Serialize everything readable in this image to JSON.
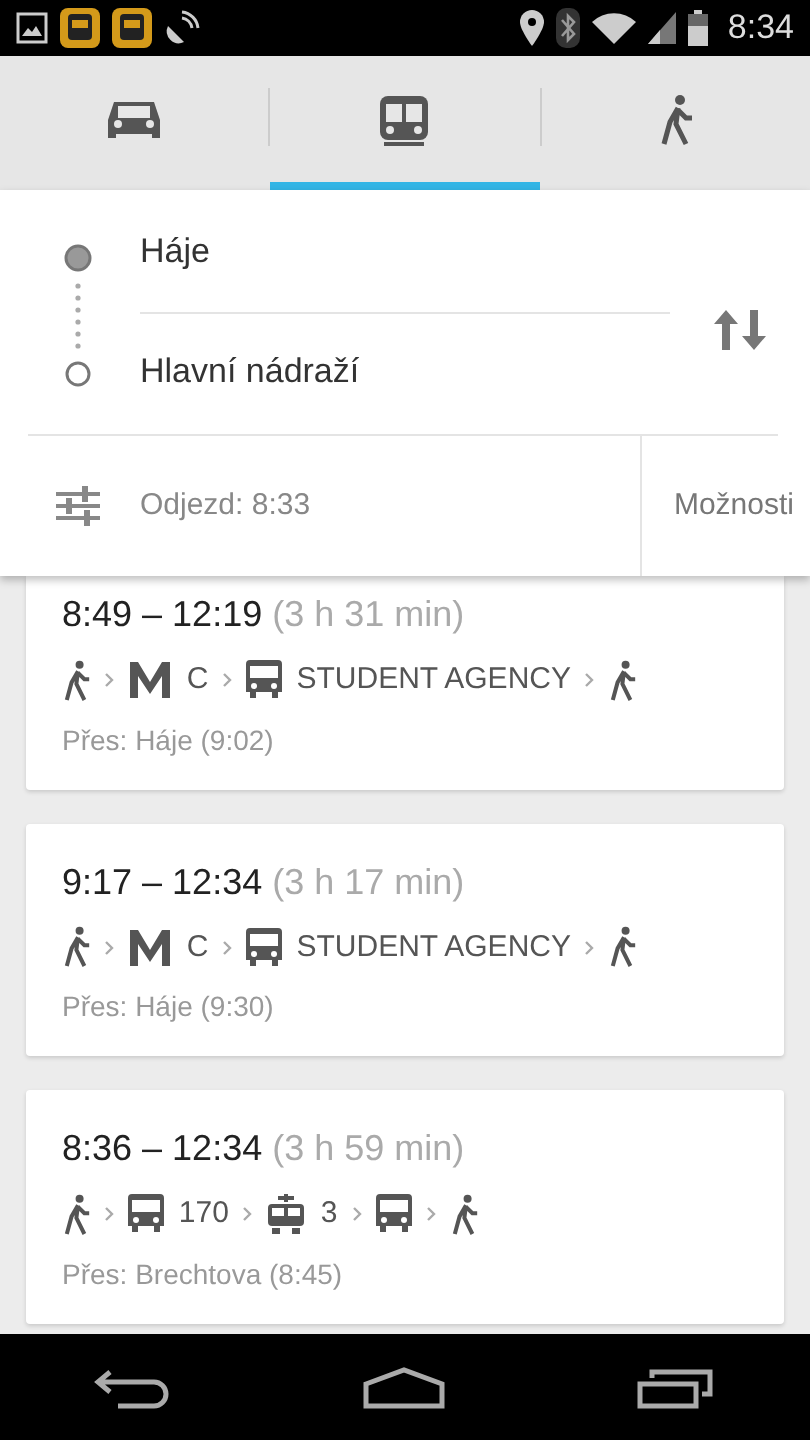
{
  "status_bar": {
    "notifications": [
      {
        "kind": "image"
      },
      {
        "kind": "bus"
      },
      {
        "kind": "bus"
      },
      {
        "kind": "satellite"
      }
    ],
    "time": "8:34"
  },
  "tabs": [
    {
      "kind": "car",
      "selected": false
    },
    {
      "kind": "transit",
      "selected": true
    },
    {
      "kind": "walk",
      "selected": false
    }
  ],
  "route": {
    "from": "Háje",
    "to": "Hlavní nádraží"
  },
  "departure": "Odjezd: 8:33",
  "options_button": "Možnosti",
  "results": [
    {
      "times": "8:49 – 12:19",
      "duration": "(3 h 31 min)",
      "steps": [
        {
          "kind": "walk"
        },
        {
          "kind": "metro",
          "label": "C"
        },
        {
          "kind": "bus",
          "label": "STUDENT AGENCY"
        },
        {
          "kind": "walk"
        }
      ],
      "via": "Přes: Háje (9:02)"
    },
    {
      "times": "9:17 – 12:34",
      "duration": "(3 h 17 min)",
      "steps": [
        {
          "kind": "walk"
        },
        {
          "kind": "metro",
          "label": "C"
        },
        {
          "kind": "bus",
          "label": "STUDENT AGENCY"
        },
        {
          "kind": "walk"
        }
      ],
      "via": "Přes: Háje (9:30)"
    },
    {
      "times": "8:36 – 12:34",
      "duration": "(3 h 59 min)",
      "steps": [
        {
          "kind": "walk"
        },
        {
          "kind": "bus",
          "label": "170"
        },
        {
          "kind": "tram",
          "label": "3"
        },
        {
          "kind": "bus"
        },
        {
          "kind": "walk"
        }
      ],
      "via": "Přes: Brechtova (8:45)"
    }
  ]
}
